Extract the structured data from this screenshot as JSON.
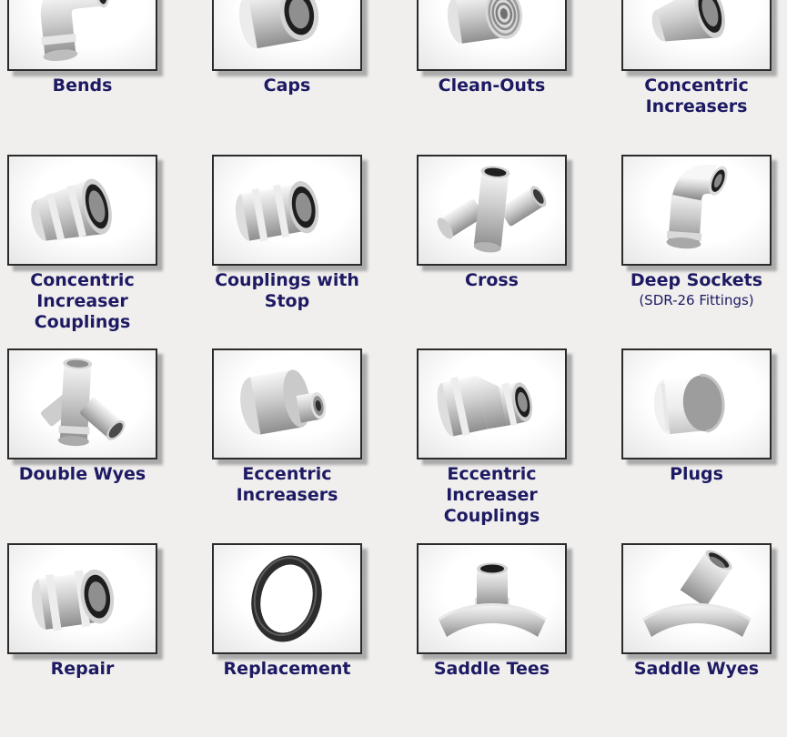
{
  "page": {
    "background_color": "#f0efed",
    "label_color": "#1d1a63"
  },
  "catalog": {
    "items": [
      {
        "label": "Bends",
        "icon": "bend-elbow-fitting"
      },
      {
        "label": "Caps",
        "icon": "cap-fitting"
      },
      {
        "label": "Clean-Outs",
        "icon": "cleanout-fitting"
      },
      {
        "label": "Concentric Increasers",
        "icon": "concentric-increaser-fitting"
      },
      {
        "label": "Concentric Increaser Couplings",
        "icon": "concentric-increaser-coupling-fitting"
      },
      {
        "label": "Couplings with Stop",
        "icon": "coupling-with-stop-fitting"
      },
      {
        "label": "Cross",
        "icon": "cross-fitting"
      },
      {
        "label": "Deep Sockets",
        "sublabel": "(SDR-26 Fittings)",
        "icon": "deep-socket-fitting"
      },
      {
        "label": "Double Wyes",
        "icon": "double-wye-fitting"
      },
      {
        "label": "Eccentric Increasers",
        "icon": "eccentric-increaser-fitting"
      },
      {
        "label": "Eccentric Increaser Couplings",
        "icon": "eccentric-increaser-coupling-fitting"
      },
      {
        "label": "Plugs",
        "icon": "plug-fitting"
      },
      {
        "label": "Repair",
        "icon": "repair-coupling-fitting"
      },
      {
        "label": "Replacement",
        "icon": "replacement-gasket"
      },
      {
        "label": "Saddle Tees",
        "icon": "saddle-tee-fitting"
      },
      {
        "label": "Saddle Wyes",
        "icon": "saddle-wye-fitting"
      }
    ]
  }
}
